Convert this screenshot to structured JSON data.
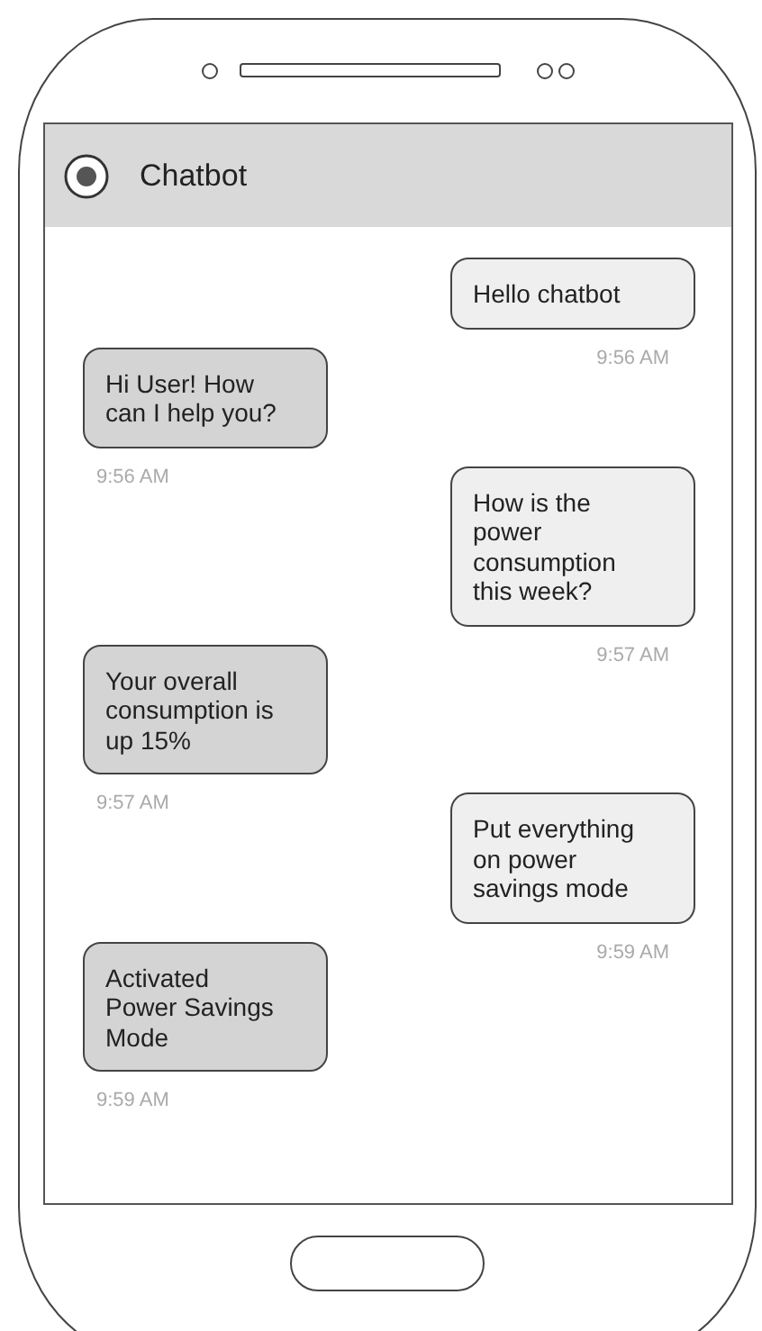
{
  "header": {
    "title": "Chatbot"
  },
  "messages": [
    {
      "kind": "sent",
      "text": "Hello chatbot",
      "time": "9:56 AM"
    },
    {
      "kind": "received",
      "text": "Hi User! How\ncan I help you?",
      "time": "9:56 AM"
    },
    {
      "kind": "sent",
      "text": "How is the\npower\nconsumption\nthis week?",
      "time": "9:57 AM"
    },
    {
      "kind": "received",
      "text": "Your overall\nconsumption is\nup 15%",
      "time": "9:57 AM"
    },
    {
      "kind": "sent",
      "text": "Put everything\non power\nsavings mode",
      "time": "9:59 AM"
    },
    {
      "kind": "received",
      "text": "Activated\nPower Savings\nMode",
      "time": "9:59 AM"
    }
  ]
}
